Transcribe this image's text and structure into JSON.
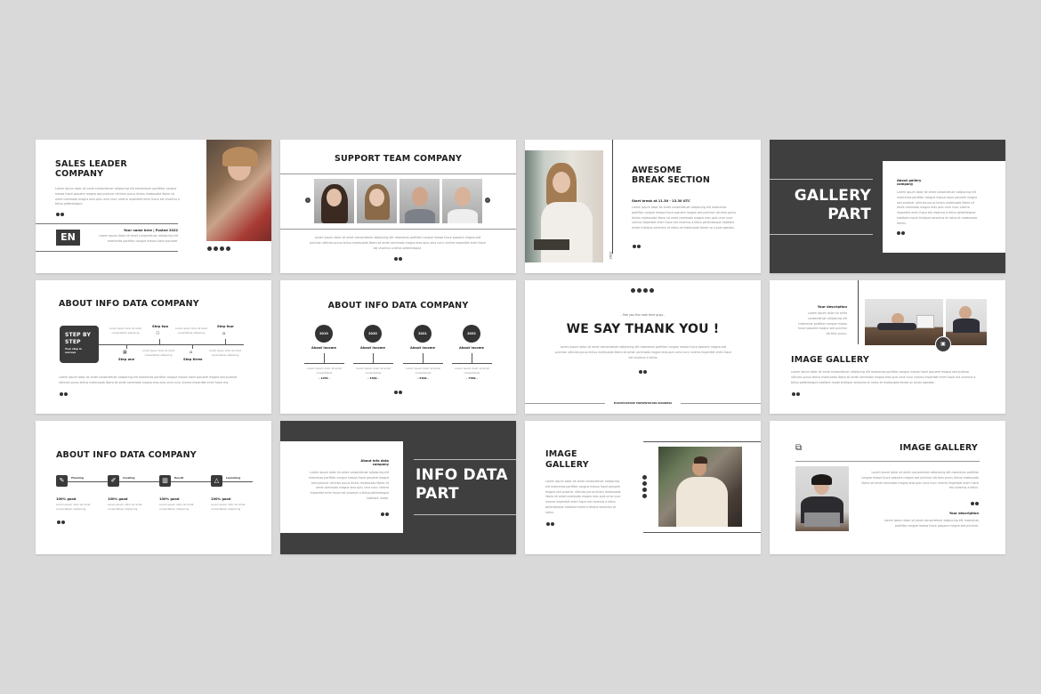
{
  "background_color": "#d9d9d9",
  "accent_dark": "#3f3f3f",
  "slides": {
    "sales_leader": {
      "title_line1": "SALES LEADER",
      "title_line2": "COMPANY",
      "body": "Lorem ipsum dolor sit amet consectetuer adipiscing elit elementum portttitor congue massa fusce posuere magna sed pulvinar ultricies purus lectus malesuada libero sit amet commodo magna eros quis urna nunc viverra imperdiet enim fusce est vivamus a tellus pellentesque.",
      "logo": "EN",
      "author": "Your name here | Posted 2022",
      "author_body": "Lorem ipsum dolor sit amet consectetuer adipiscing elit maecenas porttitor congue massa fusce posuere.",
      "social_icons": [
        "facebook-icon",
        "twitter-icon",
        "instagram-icon",
        "linkedin-icon"
      ]
    },
    "support_team": {
      "title": "SUPPORT TEAM COMPANY",
      "body": "Lorem ipsum dolor sit amet consectetuer adipiscing elit maecenas porttitor congue massa fusce posuere magna sed pulvinar ultricies purus lectus malesuada libero sit amet commodo magna eros quis urna nunc viverra imperdiet enim fusce est vivamus a tellus pellentesque.",
      "prev_icon": "chevron-left-icon",
      "next_icon": "chevron-right-icon",
      "members": 4
    },
    "break_section": {
      "title_line1": "AWESOME",
      "title_line2": "BREAK SECTION",
      "subtitle": "Start break at 11.30 - 13.30 UTC",
      "body": "Lorem ipsum dolor sit amet consectetuer adipiscing elit maecenas porttitor congue massa fusce posuere magna sed pulvinar ultricies purus lectus malesuada libero sit amet commodo magna eros quis urna nunc viverra imperdiet enim fusce est vivamus a tellus pellentesque habitant morbi tristique senectus et netus et malesuada fames ac turpis egestas.",
      "vertical_label": "2022"
    },
    "gallery_part": {
      "title_line1": "GALLERY",
      "title_line2": "PART",
      "card_title": "About gallery company",
      "card_body": "Lorem ipsum dolor sit amet consectetuer adipiscing elit maecenas porttitor congue massa fusce posuere magna sed pulvinar ultricies purus lectus malesuada libero sit amet commodo magna eros quis urna nunc viverra imperdiet enim fusce est vivamus a tellus pellentesque habitant morbi tristique senectus et netus et malesuada fames."
    },
    "step_by_step": {
      "title": "ABOUT INFO DATA COMPANY",
      "box_title_line1": "STEP BY",
      "box_title_line2": "STEP",
      "box_sub": "Your step in success",
      "steps": [
        {
          "label": "Step one",
          "text": "Lorem ipsum dolor sit amet consectetuer adipiscing",
          "icon": "chart-icon"
        },
        {
          "label": "Step two",
          "text": "Lorem ipsum dolor sit amet consectetuer adipiscing",
          "icon": "people-icon"
        },
        {
          "label": "Step three",
          "text": "Lorem ipsum dolor sit amet consectetuer adipiscing",
          "icon": "building-icon"
        },
        {
          "label": "Step four",
          "text": "Lorem ipsum dolor sit amet consectetuer adipiscing",
          "icon": "home-icon"
        }
      ],
      "body": "Lorem ipsum dolor sit amet consectetuer adipiscing elit maecenas porttitor congue massa fusce posuere magna sed pulvinar ultricies purus lectus malesuada libero sit amet commodo magna eros quis urna nunc viverra imperdiet enim fusce est."
    },
    "yearly_income": {
      "title": "ABOUT INFO DATA COMPANY",
      "items": [
        {
          "year": "2019",
          "label": "About income",
          "text": "Lorem ipsum dolor sit amet consectetuer",
          "value": "- 125k -"
        },
        {
          "year": "2020",
          "label": "About income",
          "text": "Lorem ipsum dolor sit amet consectetuer",
          "value": "- 330k -"
        },
        {
          "year": "2021",
          "label": "About income",
          "text": "Lorem ipsum dolor sit amet consectetuer",
          "value": "- 540k -"
        },
        {
          "year": "2022",
          "label": "About income",
          "text": "Lorem ipsum dolor sit amet consectetuer",
          "value": "- 758k -"
        }
      ]
    },
    "thank_you": {
      "kicker": "- See you the next time guys -",
      "title": "WE SAY THANK YOU !",
      "body": "Lorem ipsum dolor sit amet consectetuer adipiscing elit maecenas porttitor congue massa fusce posuere magna sed pulvinar ultricies purus lectus malesuada libero sit amet commodo magna eros quis urna nunc viverra imperdiet enim fusce est vivamus a tellus.",
      "footer": "MULTIPURPOSE PRESENTATION BUSINESS"
    },
    "image_gallery_a": {
      "desc_title": "Your description",
      "desc_body": "Lorem ipsum dolor sit amet consectetuer adipiscing elit maecenas porttitor congue massa fusce posuere magna sed pulvinar ultricies purus.",
      "title": "IMAGE GALLERY",
      "body": "Lorem ipsum dolor sit amet consectetuer adipiscing elit maecenas porttitor congue massa fusce posuere magna sed pulvinar ultricies purus lectus malesuada libero sit amet commodo magna eros quis urna nunc viverra imperdiet enim fusce est vivamus a tellus pellentesque habitant morbi tristique senectus et netus et malesuada fames ac turpis egestas."
    },
    "process": {
      "title": "ABOUT INFO DATA COMPANY",
      "items": [
        {
          "label": "Planning",
          "stat": "100% good",
          "text": "Lorem ipsum dolor sit amet consectetuer adipiscing",
          "icon": "pencil-icon"
        },
        {
          "label": "Creating",
          "stat": "100% good",
          "text": "Lorem ipsum dolor sit amet consectetuer adipiscing",
          "icon": "edit-icon"
        },
        {
          "label": "Result",
          "stat": "100% good",
          "text": "Lorem ipsum dolor sit amet consectetuer adipiscing",
          "icon": "chart-icon"
        },
        {
          "label": "Launching",
          "stat": "100% good",
          "text": "Lorem ipsum dolor sit amet consectetuer adipiscing",
          "icon": "rocket-icon"
        }
      ]
    },
    "info_data_part": {
      "card_title": "About info data company",
      "card_body": "Lorem ipsum dolor sit amet consectetuer adipiscing elit maecenas porttitor congue massa fusce posuere magna sed pulvinar ultricies purus lectus malesuada libero sit amet commodo magna eros quis urna nunc viverra imperdiet enim fusce est vivamus a tellus pellentesque habitant morbi.",
      "title_line1": "INFO DATA",
      "title_line2": "PART"
    },
    "image_gallery_b": {
      "title_line1": "IMAGE",
      "title_line2": "GALLERY",
      "body": "Lorem ipsum dolor sit amet consectetuer adipiscing elit maecenas porttitor congue massa fusce posuere magna sed pulvinar ultricies purus lectus malesuada libero sit amet commodo magna eros quis urna nunc viverra imperdiet enim fusce est vivamus a tellus pellentesque habitant morbi tristique senectus et netus."
    },
    "image_gallery_c": {
      "title": "IMAGE GALLERY",
      "body": "Lorem ipsum dolor sit amet consectetuer adipiscing elit maecenas porttitor congue massa fusce posuere magna sed pulvinar ultricies purus lectus malesuada libero sit amet commodo magna eros quis urna nunc viverra imperdiet enim fusce est vivamus a tellus.",
      "desc_title": "Your description",
      "desc_body": "Lorem ipsum dolor sit amet consectetuer adipiscing elit maecenas porttitor congue massa fusce posuere magna sed pulvinar."
    }
  }
}
